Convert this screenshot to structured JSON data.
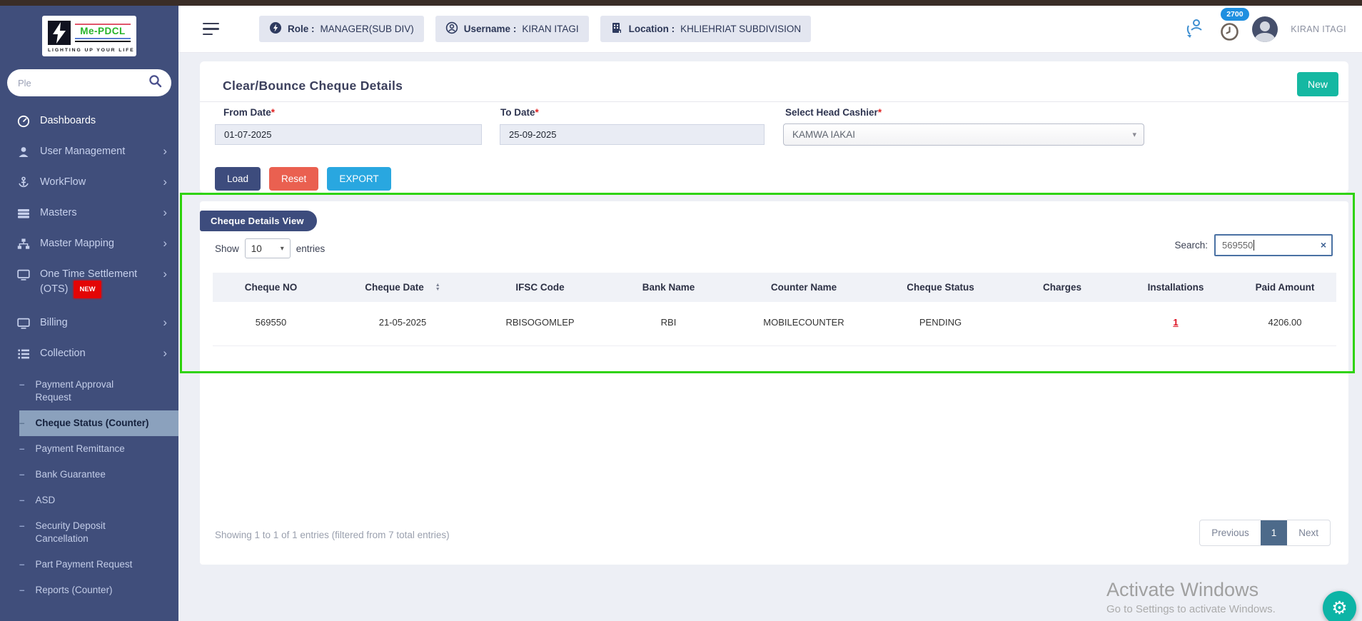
{
  "colors": {
    "sidebar": "#404e7b",
    "teal": "#15b8a2",
    "navy": "#3d4c7d",
    "reset": "#ea6050",
    "export": "#29a7e0",
    "green": "#2fd30d",
    "badge_blue": "#1e8fe0",
    "pagination_active": "#4d6a8a",
    "link_red": "#dd1122"
  },
  "icons": {
    "gear": "⚙",
    "clear": "×",
    "caret_down": "▾",
    "chevron_right": "›",
    "dash": "–",
    "sort_asc": "▲",
    "sort_desc": "▼"
  },
  "sidebar": {
    "logo": {
      "brand": "Me-PDCL",
      "tagline": "LIGHTING UP YOUR LIFE"
    },
    "search": {
      "placeholder": "Ple"
    },
    "items": [
      {
        "label": "Dashboards"
      },
      {
        "label": "User Management"
      },
      {
        "label": "WorkFlow"
      },
      {
        "label": "Masters"
      },
      {
        "label": "Master Mapping"
      },
      {
        "label": "One Time Settlement (OTS)",
        "badge": "NEW"
      },
      {
        "label": "Billing"
      },
      {
        "label": "Collection"
      }
    ],
    "subitems": [
      {
        "label": "Payment Approval Request"
      },
      {
        "label": "Cheque Status (Counter)"
      },
      {
        "label": "Payment Remittance"
      },
      {
        "label": "Bank Guarantee"
      },
      {
        "label": "ASD"
      },
      {
        "label": "Security Deposit Cancellation"
      },
      {
        "label": "Part Payment Request"
      },
      {
        "label": "Reports (Counter)"
      }
    ]
  },
  "header": {
    "badges": [
      {
        "label": "Role :",
        "value": "MANAGER(SUB DIV)"
      },
      {
        "label": "Username :",
        "value": "KIRAN ITAGI"
      },
      {
        "label": "Location :",
        "value": "KHLIEHRIAT SUBDIVISION"
      }
    ],
    "clock_badge": "2700",
    "user_name": "KIRAN ITAGI"
  },
  "page": {
    "title": "Clear/Bounce Cheque Details",
    "new_button": "New",
    "form": {
      "from_date": {
        "label": "From Date",
        "required": "*",
        "value": "01-07-2025"
      },
      "to_date": {
        "label": "To Date",
        "required": "*",
        "value": "25-09-2025"
      },
      "head_cashier": {
        "label": "Select Head Cashier",
        "required": "*",
        "value": "KAMWA IAKAI"
      }
    },
    "buttons": {
      "load": "Load",
      "reset": "Reset",
      "export": "EXPORT"
    }
  },
  "table_section": {
    "badge": "Cheque Details View",
    "show_label": "Show",
    "show_value": "10",
    "entries_label": "entries",
    "search_label": "Search:",
    "search_value": "569550",
    "columns": [
      "Cheque NO",
      "Cheque Date",
      "IFSC Code",
      "Bank Name",
      "Counter Name",
      "Cheque Status",
      "Charges",
      "Installations",
      "Paid Amount"
    ],
    "rows": [
      [
        "569550",
        "21-05-2025",
        "RBISOGOMLEP",
        "RBI",
        "MOBILECOUNTER",
        "PENDING",
        "",
        "1",
        "4206.00"
      ]
    ],
    "footer_text": "Showing 1 to 1 of 1 entries (filtered from 7 total entries)",
    "pagination": {
      "previous": "Previous",
      "current": "1",
      "next": "Next"
    }
  },
  "watermark": {
    "line1": "Activate Windows",
    "line2": "Go to Settings to activate Windows."
  }
}
